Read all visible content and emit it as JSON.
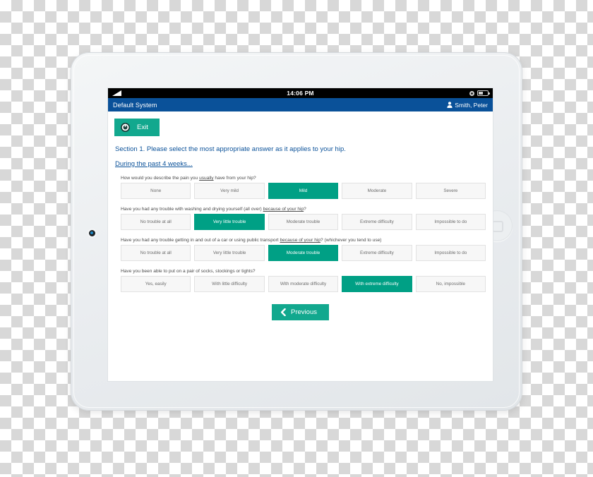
{
  "device": {
    "camera_icon": "camera-dot-icon",
    "home_button_icon": "home-button-icon"
  },
  "status_bar": {
    "signal_icon": "signal-strength-icon",
    "time": "14:06 PM",
    "lock_icon": "rotation-lock-icon",
    "battery_icon": "battery-icon"
  },
  "app_header": {
    "title": "Default System",
    "user_icon": "person-icon",
    "user_name": "Smith, Peter"
  },
  "toolbar": {
    "exit_icon": "power-icon",
    "exit_label": "Exit"
  },
  "content": {
    "section_heading": "Section 1. Please select the most appropriate answer as it applies to your hip.",
    "timeframe_heading": "During the past 4 weeks...",
    "questions": [
      {
        "text_before": "How would you describe the pain you ",
        "text_underline": "usually",
        "text_after": " have from your hip?",
        "options": [
          "None",
          "Very mild",
          "Mild",
          "Moderate",
          "Severe"
        ],
        "selected_index": 2
      },
      {
        "text_before": "Have you had any trouble with washing and drying yourself (all over) ",
        "text_underline": "because of your hip",
        "text_after": "?",
        "options": [
          "No trouble at all",
          "Very little trouble",
          "Moderate trouble",
          "Extreme difficulty",
          "Impossible to do"
        ],
        "selected_index": 1
      },
      {
        "text_before": "Have you had any trouble getting in and out of a car or using public transport ",
        "text_underline": "because of your hip",
        "text_after": "? (whichever you tend to use)",
        "options": [
          "No trouble at all",
          "Very little trouble",
          "Moderate trouble",
          "Extreme difficulty",
          "Impossible to do"
        ],
        "selected_index": 2
      },
      {
        "text_before": "Have you been able to put on a pair of socks, stockings or tights?",
        "text_underline": "",
        "text_after": "",
        "options": [
          "Yes, easily",
          "With little difficulty",
          "With moderate difficulty",
          "With extreme difficulty",
          "No, impossible"
        ],
        "selected_index": 3
      }
    ]
  },
  "navigation": {
    "previous_icon": "chevron-left-icon",
    "previous_label": "Previous"
  },
  "colors": {
    "header_blue": "#0a5199",
    "accent_teal": "#12a88e",
    "selected_teal": "#00a085",
    "option_bg": "#f7f7f7"
  }
}
